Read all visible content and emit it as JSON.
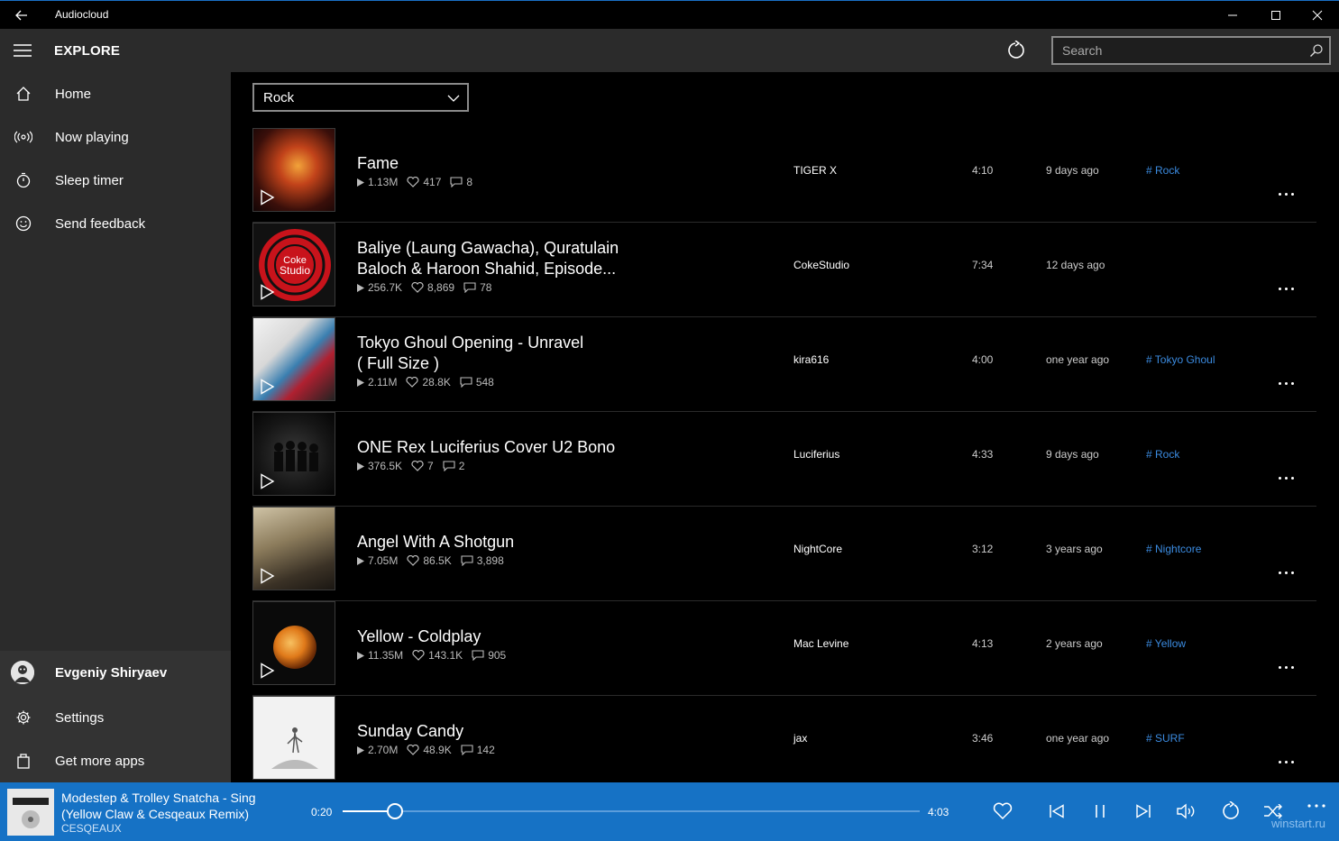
{
  "window": {
    "title": "Audiocloud"
  },
  "header": {
    "title": "EXPLORE",
    "search_placeholder": "Search"
  },
  "sidebar": {
    "items": [
      {
        "label": "Home",
        "icon": "home-icon"
      },
      {
        "label": "Now playing",
        "icon": "broadcast-icon"
      },
      {
        "label": "Sleep timer",
        "icon": "timer-icon"
      },
      {
        "label": "Send feedback",
        "icon": "smiley-icon"
      }
    ],
    "user": {
      "name": "Evgeniy  Shiryaev"
    },
    "bottom_items": [
      {
        "label": "Settings",
        "icon": "gear-icon"
      },
      {
        "label": "Get more apps",
        "icon": "store-icon"
      }
    ]
  },
  "genre": {
    "selected": "Rock"
  },
  "tracks": [
    {
      "title_line1": "Fame",
      "title_line2": "",
      "plays": "1.13M",
      "likes": "417",
      "comments": "8",
      "artist": "TIGER X",
      "duration": "4:10",
      "age": "9 days ago",
      "tag": "# Rock"
    },
    {
      "title_line1": "Baliye (Laung Gawacha), Quratulain",
      "title_line2": "Baloch & Haroon Shahid, Episode...",
      "plays": "256.7K",
      "likes": "8,869",
      "comments": "78",
      "artist": "CokeStudio",
      "duration": "7:34",
      "age": "12 days ago",
      "tag": ""
    },
    {
      "title_line1": "Tokyo Ghoul Opening - Unravel",
      "title_line2": "( Full Size )",
      "plays": "2.11M",
      "likes": "28.8K",
      "comments": "548",
      "artist": "kira616",
      "duration": "4:00",
      "age": "one year ago",
      "tag": "# Tokyo Ghoul"
    },
    {
      "title_line1": "ONE Rex Luciferius Cover U2 Bono",
      "title_line2": "",
      "plays": "376.5K",
      "likes": "7",
      "comments": "2",
      "artist": "Luciferius",
      "duration": "4:33",
      "age": "9 days ago",
      "tag": "# Rock"
    },
    {
      "title_line1": "Angel With A Shotgun",
      "title_line2": "",
      "plays": "7.05M",
      "likes": "86.5K",
      "comments": "3,898",
      "artist": "NightCore",
      "duration": "3:12",
      "age": "3 years ago",
      "tag": "# Nightcore"
    },
    {
      "title_line1": "Yellow - Coldplay",
      "title_line2": "",
      "plays": "11.35M",
      "likes": "143.1K",
      "comments": "905",
      "artist": "Mac Levine",
      "duration": "4:13",
      "age": "2 years ago",
      "tag": "# Yellow"
    },
    {
      "title_line1": "Sunday Candy",
      "title_line2": "",
      "plays": "2.70M",
      "likes": "48.9K",
      "comments": "142",
      "artist": "jax",
      "duration": "3:46",
      "age": "one year ago",
      "tag": "# SURF"
    }
  ],
  "player": {
    "title_line1": "Modestep & Trolley Snatcha - Sing",
    "title_line2": "(Yellow Claw & Cesqeaux Remix)",
    "artist": "CESQEAUX",
    "current_time": "0:20",
    "total_time": "4:03",
    "progress": 0.09,
    "watermark": "winstart.ru"
  },
  "colors": {
    "accent": "#1672c5",
    "tag": "#3b8be0",
    "sidebar": "#2b2b2b"
  }
}
